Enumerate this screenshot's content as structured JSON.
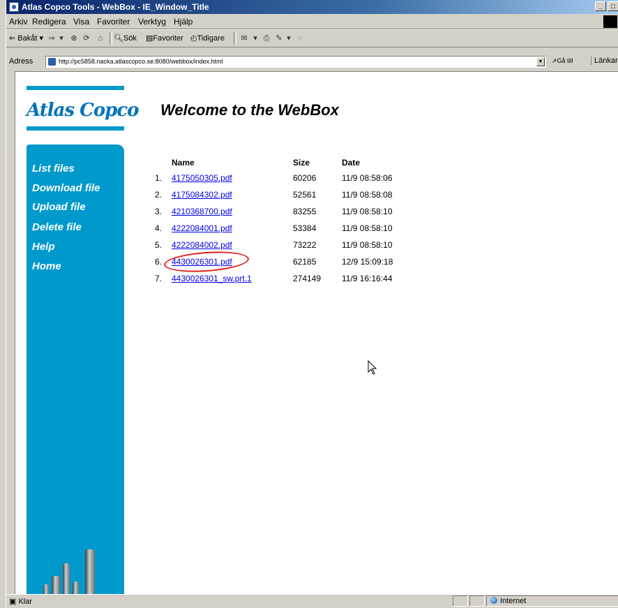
{
  "window": {
    "title": "Atlas Copco Tools - WebBox - IE_Window_Title"
  },
  "menu": [
    "Arkiv",
    "Redigera",
    "Visa",
    "Favoriter",
    "Verktyg",
    "Hjälp"
  ],
  "toolbar": {
    "back": "Bakåt",
    "search": "Sök",
    "favorites": "Favoriter",
    "history": "Tidigare"
  },
  "address": {
    "label": "Adress",
    "url": "http://pc5858.nacka.atlascopco.se:8080/webbox/index.html",
    "go": "Gå till",
    "links": "Länkar"
  },
  "page": {
    "logo": "Atlas Copco",
    "welcome": "Welcome to the WebBox",
    "nav": [
      "List files",
      "Download file",
      "Upload file",
      "Delete file",
      "Help",
      "Home"
    ],
    "columns": {
      "name": "Name",
      "size": "Size",
      "date": "Date"
    },
    "files": [
      {
        "num": "1.",
        "name": "4175050305.pdf",
        "size": "60206",
        "date": "11/9  08:58:06"
      },
      {
        "num": "2.",
        "name": "4175084302.pdf",
        "size": "52561",
        "date": "11/9  08:58:08"
      },
      {
        "num": "3.",
        "name": "4210368700.pdf",
        "size": "83255",
        "date": "11/9  08:58:10"
      },
      {
        "num": "4.",
        "name": "4222084001.pdf",
        "size": "53384",
        "date": "11/9  08:58:10"
      },
      {
        "num": "5.",
        "name": "4222084002.pdf",
        "size": "73222",
        "date": "11/9  08:58:10"
      },
      {
        "num": "6.",
        "name": "4430026301.pdf",
        "size": "62185",
        "date": "12/9  15:09:18"
      },
      {
        "num": "7.",
        "name": "4430026301_sw.prt.1",
        "size": "274149",
        "date": "11/9  16:16:44"
      }
    ]
  },
  "status": {
    "left": "Klar",
    "zone": "Internet"
  }
}
